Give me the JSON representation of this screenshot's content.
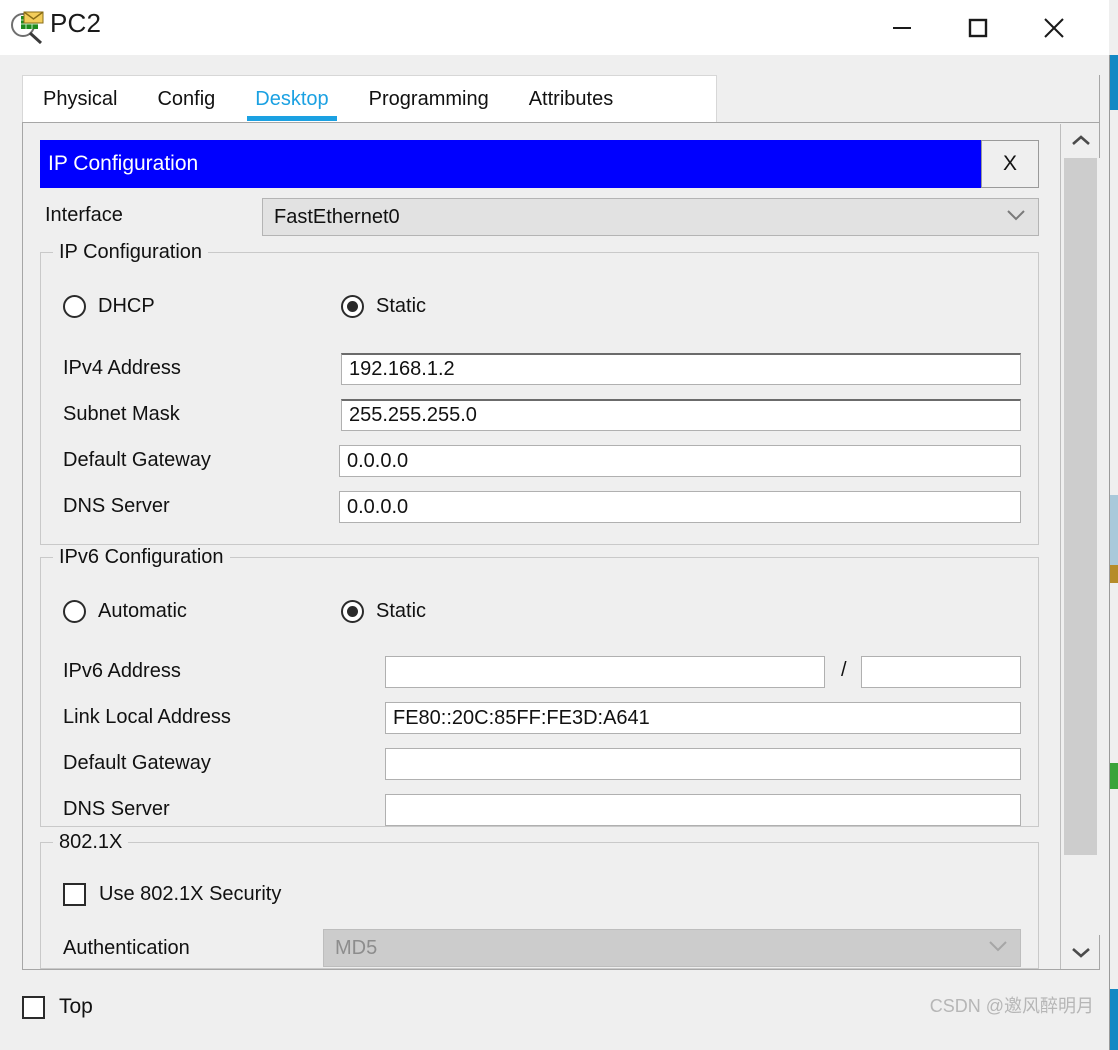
{
  "window": {
    "title": "PC2",
    "icon": "inspect-packet-icon",
    "controls": {
      "minimize": "—",
      "maximize": "□",
      "close": "✕"
    }
  },
  "tabs": [
    {
      "label": "Physical",
      "active": false
    },
    {
      "label": "Config",
      "active": false
    },
    {
      "label": "Desktop",
      "active": true
    },
    {
      "label": "Programming",
      "active": false
    },
    {
      "label": "Attributes",
      "active": false
    }
  ],
  "dialog": {
    "title": "IP Configuration",
    "close_label": "X",
    "header_color": "#0000ff",
    "accent_color": "#1ba1e2"
  },
  "interface": {
    "label": "Interface",
    "value": "FastEthernet0"
  },
  "ipv4": {
    "legend": "IP Configuration",
    "modes": [
      {
        "label": "DHCP",
        "selected": false
      },
      {
        "label": "Static",
        "selected": true
      }
    ],
    "fields": [
      {
        "label": "IPv4 Address",
        "value": "192.168.1.2"
      },
      {
        "label": "Subnet Mask",
        "value": "255.255.255.0"
      },
      {
        "label": "Default Gateway",
        "value": "0.0.0.0"
      },
      {
        "label": "DNS Server",
        "value": "0.0.0.0"
      }
    ]
  },
  "ipv6": {
    "legend": "IPv6 Configuration",
    "modes": [
      {
        "label": "Automatic",
        "selected": false
      },
      {
        "label": "Static",
        "selected": true
      }
    ],
    "address_label": "IPv6 Address",
    "address_value": "",
    "prefix_separator": "/",
    "prefix_value": "",
    "fields": [
      {
        "label": "Link Local Address",
        "value": "FE80::20C:85FF:FE3D:A641"
      },
      {
        "label": "Default Gateway",
        "value": ""
      },
      {
        "label": "DNS Server",
        "value": ""
      }
    ]
  },
  "dot1x": {
    "legend": "802.1X",
    "use_security_label": "Use 802.1X Security",
    "use_security_checked": false,
    "auth_label": "Authentication",
    "auth_value": "MD5",
    "auth_disabled": true
  },
  "footer": {
    "top_label": "Top",
    "top_checked": false,
    "watermark": "CSDN @邀风醉明月"
  }
}
